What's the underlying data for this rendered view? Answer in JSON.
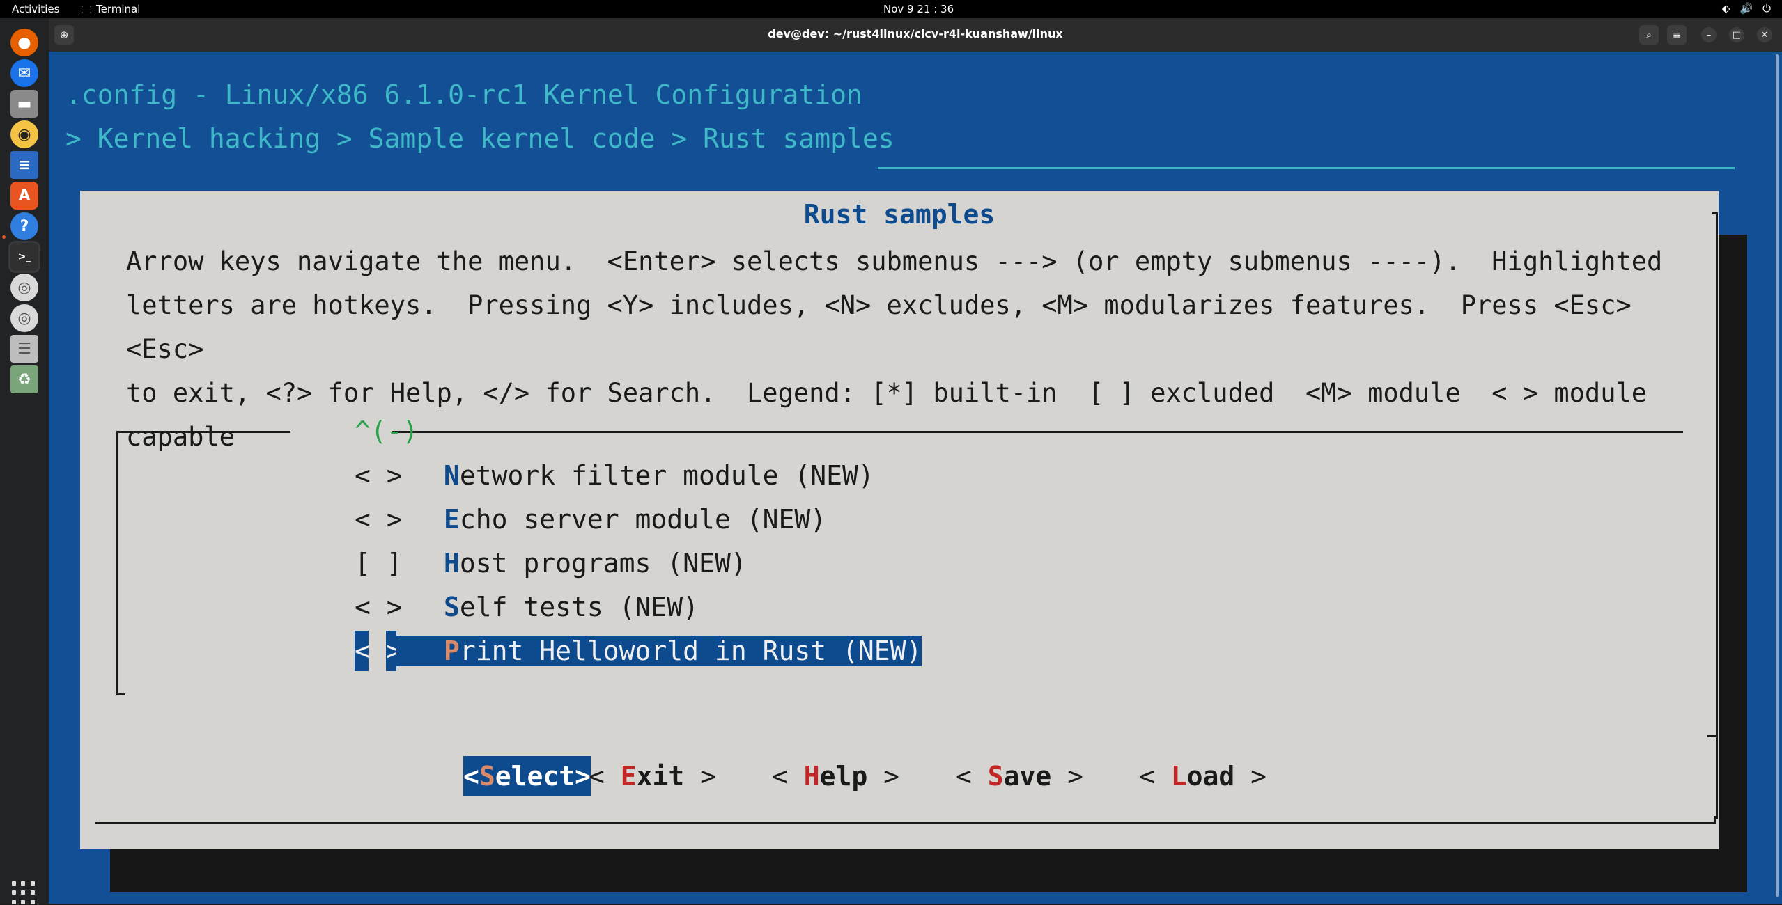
{
  "topbar": {
    "activities": "Activities",
    "app_name": "Terminal",
    "clock": "Nov 9  21 : 36"
  },
  "dock": {
    "items": [
      {
        "name": "firefox-icon",
        "color": "#e66000"
      },
      {
        "name": "thunderbird-icon",
        "color": "#1a73e8"
      },
      {
        "name": "files-icon",
        "color": "#a8a8a8"
      },
      {
        "name": "rhythmbox-icon",
        "color": "#f6c445"
      },
      {
        "name": "libreoffice-writer-icon",
        "color": "#2a6ac2"
      },
      {
        "name": "app-center-icon",
        "color": "#e95420"
      },
      {
        "name": "help-icon",
        "color": "#2f7ee0"
      },
      {
        "name": "terminal-icon",
        "color": "#303030"
      },
      {
        "name": "disc-icon",
        "color": "#d9d9d9"
      },
      {
        "name": "disc-icon-2",
        "color": "#d9d9d9"
      },
      {
        "name": "save-drive-icon",
        "color": "#bdbdbd"
      },
      {
        "name": "trash-icon",
        "color": "#7aa57a"
      }
    ]
  },
  "window": {
    "title": "dev@dev: ~/rust4linux/cicv-r4l-kuanshaw/linux"
  },
  "terminal": {
    "config_title": ".config - Linux/x86 6.1.0-rc1 Kernel Configuration",
    "breadcrumb": "> Kernel hacking > Sample kernel code > Rust samples"
  },
  "dialog": {
    "title": "Rust samples",
    "help_lines": [
      "Arrow keys navigate the menu.  <Enter> selects submenus ---> (or empty submenus ----).  Highlighted",
      "letters are hotkeys.  Pressing <Y> includes, <N> excludes, <M> modularizes features.  Press <Esc><Esc>",
      "to exit, <?> for Help, </> for Search.  Legend: [*] built-in  [ ] excluded  <M> module  < > module",
      "capable"
    ],
    "scroll_indicator": "^(-)",
    "menu_items": [
      {
        "mark": "< >",
        "hotkey": "N",
        "rest": "etwork filter module (NEW)",
        "selected": false
      },
      {
        "mark": "< >",
        "hotkey": "E",
        "rest": "cho server module (NEW)",
        "selected": false
      },
      {
        "mark": "[ ]",
        "hotkey": "H",
        "rest": "ost programs (NEW)",
        "selected": false
      },
      {
        "mark": "< >",
        "hotkey": "S",
        "rest": "elf tests (NEW)",
        "selected": false
      },
      {
        "mark": "< >",
        "hotkey": "P",
        "rest": "rint Helloworld in Rust (NEW)",
        "selected": true
      }
    ],
    "buttons": {
      "select": {
        "open": "<",
        "hotkey": "S",
        "rest": "elect",
        "close": ">"
      },
      "exit": {
        "open": "< ",
        "hotkey": "E",
        "rest": "xit",
        "close": " >"
      },
      "help": {
        "open": "< ",
        "hotkey": "H",
        "rest": "elp",
        "close": " >"
      },
      "save": {
        "open": "< ",
        "hotkey": "S",
        "rest": "ave",
        "close": " >"
      },
      "load": {
        "open": "< ",
        "hotkey": "L",
        "rest": "oad",
        "close": " >"
      }
    }
  }
}
